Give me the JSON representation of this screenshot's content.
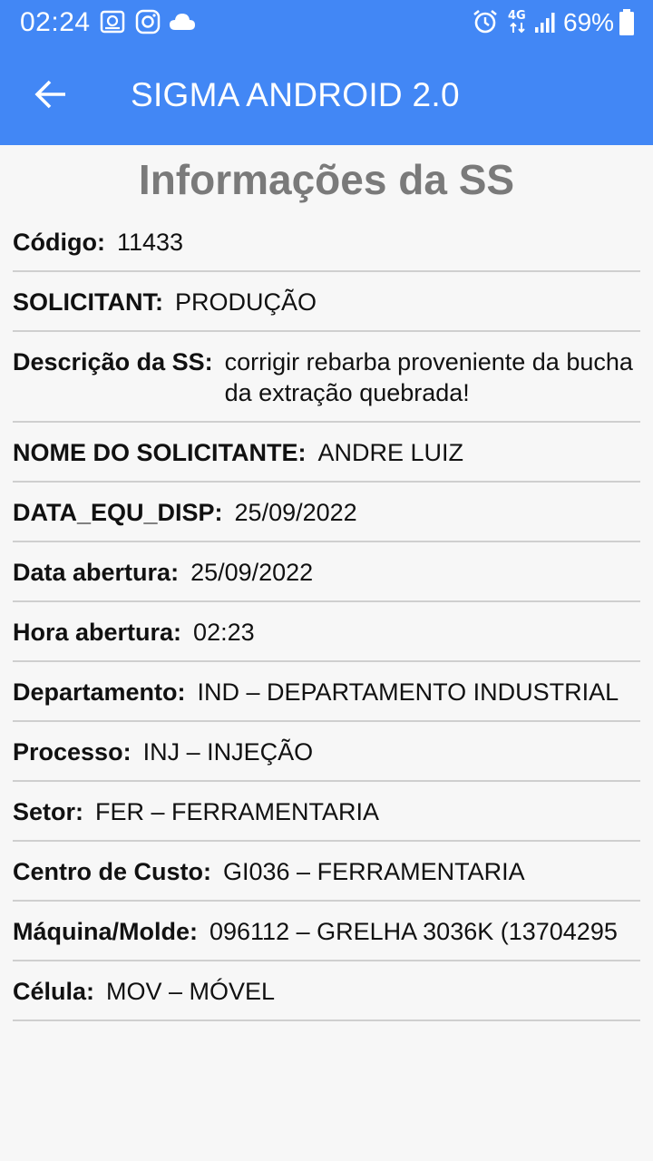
{
  "statusbar": {
    "time": "02:24",
    "battery": "69%",
    "network": "4G"
  },
  "appbar": {
    "title": "SIGMA ANDROID 2.0"
  },
  "page": {
    "title": "Informações da SS"
  },
  "fields": [
    {
      "label": "Código:",
      "value": "11433"
    },
    {
      "label": "SOLICITANT:",
      "value": "PRODUÇÃO"
    },
    {
      "label": "Descrição da SS:",
      "value": "corrigir rebarba proveniente da bucha da extração quebrada!"
    },
    {
      "label": "NOME DO SOLICITANTE:",
      "value": "ANDRE LUIZ"
    },
    {
      "label": "DATA_EQU_DISP:",
      "value": "25/09/2022"
    },
    {
      "label": "Data abertura:",
      "value": "25/09/2022"
    },
    {
      "label": "Hora abertura:",
      "value": "02:23"
    },
    {
      "label": "Departamento:",
      "value": "IND –  DEPARTAMENTO INDUSTRIAL"
    },
    {
      "label": "Processo:",
      "value": "INJ – INJEÇÃO"
    },
    {
      "label": "Setor:",
      "value": "FER – FERRAMENTARIA"
    },
    {
      "label": "Centro de Custo:",
      "value": "GI036 – FERRAMENTARIA"
    },
    {
      "label": "Máquina/Molde:",
      "value": "096112 – GRELHA 3036K (13704295"
    },
    {
      "label": "Célula:",
      "value": "MOV – MÓVEL"
    }
  ],
  "colors": {
    "accent": "#4287f5",
    "title_gray": "#7a7a7a",
    "divider": "#cfcfcf",
    "background": "#f7f7f7"
  },
  "icons": [
    "back-arrow-icon",
    "gallery-icon",
    "instagram-icon",
    "cloud-icon",
    "alarm-icon",
    "network-4g-icon",
    "signal-icon",
    "battery-icon"
  ]
}
